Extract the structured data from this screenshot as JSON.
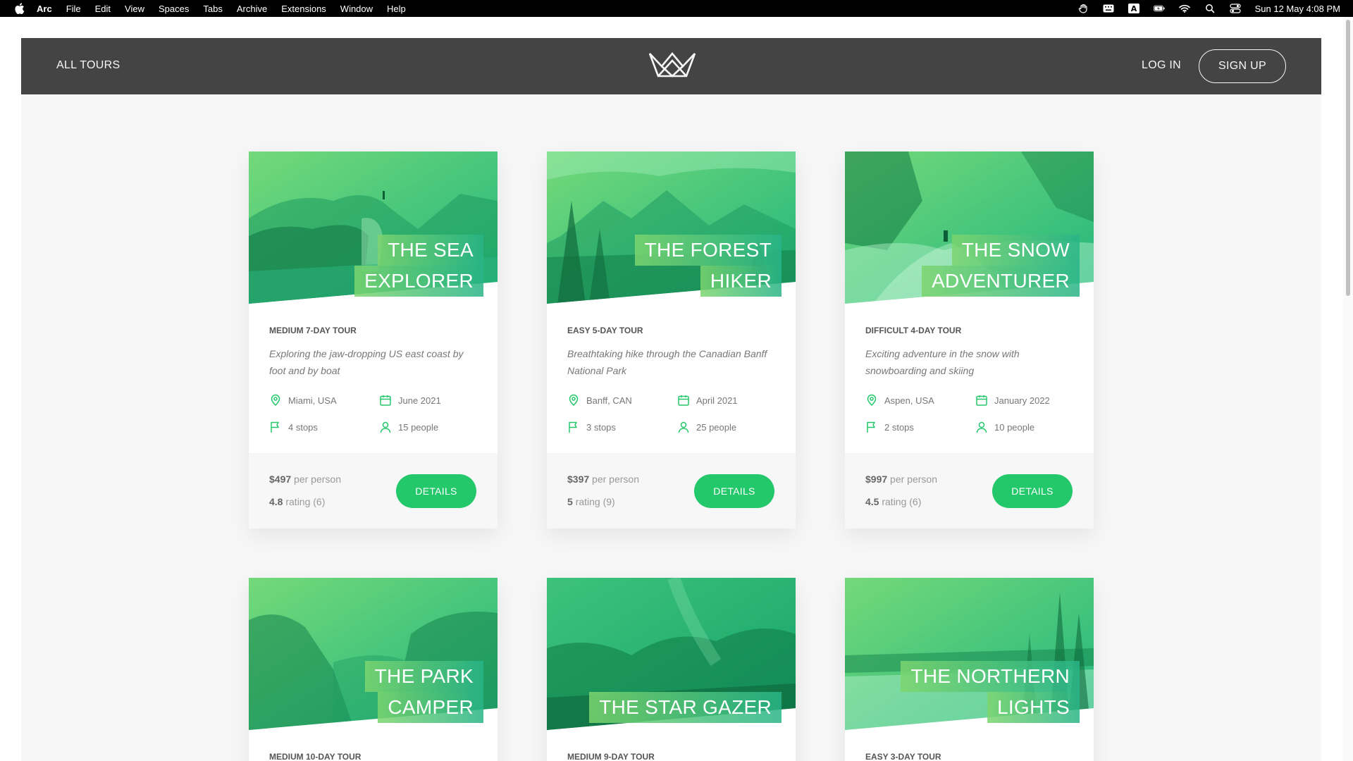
{
  "menubar": {
    "app": "Arc",
    "items": [
      "File",
      "Edit",
      "View",
      "Spaces",
      "Tabs",
      "Archive",
      "Extensions",
      "Window",
      "Help"
    ],
    "clock": "Sun 12 May  4:08 PM",
    "status_icons": [
      "hand-icon",
      "keyboard-icon",
      "input-source-a-icon",
      "battery-icon",
      "wifi-icon",
      "search-icon",
      "control-center-icon"
    ]
  },
  "header": {
    "all_tours": "ALL TOURS",
    "login": "LOG IN",
    "signup": "SIGN UP",
    "logo": "crown-logo-icon"
  },
  "colors": {
    "accent": "#23c86a",
    "header_bg": "#444444",
    "gradient_start": "#7dd56f",
    "gradient_end": "#28b487"
  },
  "tours": [
    {
      "title_lines": [
        "THE SEA",
        "EXPLORER"
      ],
      "subheading": "MEDIUM 7-DAY TOUR",
      "summary": "Exploring the jaw-dropping US east coast by foot and by boat",
      "location": "Miami, USA",
      "date": "June 2021",
      "stops": "4 stops",
      "people": "15 people",
      "price": "$497",
      "price_label": "per person",
      "rating": "4.8",
      "rating_label": "rating (6)",
      "button": "DETAILS"
    },
    {
      "title_lines": [
        "THE FOREST",
        "HIKER"
      ],
      "subheading": "EASY 5-DAY TOUR",
      "summary": "Breathtaking hike through the Canadian Banff National Park",
      "location": "Banff, CAN",
      "date": "April 2021",
      "stops": "3 stops",
      "people": "25 people",
      "price": "$397",
      "price_label": "per person",
      "rating": "5",
      "rating_label": "rating (9)",
      "button": "DETAILS"
    },
    {
      "title_lines": [
        "THE SNOW",
        "ADVENTURER"
      ],
      "subheading": "DIFFICULT 4-DAY TOUR",
      "summary": "Exciting adventure in the snow with snowboarding and skiing",
      "location": "Aspen, USA",
      "date": "January 2022",
      "stops": "2 stops",
      "people": "10 people",
      "price": "$997",
      "price_label": "per person",
      "rating": "4.5",
      "rating_label": "rating (6)",
      "button": "DETAILS"
    },
    {
      "title_lines": [
        "THE PARK",
        "CAMPER"
      ],
      "subheading": "MEDIUM 10-DAY TOUR"
    },
    {
      "title_lines": [
        "THE STAR GAZER"
      ],
      "subheading": "MEDIUM 9-DAY TOUR"
    },
    {
      "title_lines": [
        "THE NORTHERN",
        "LIGHTS"
      ],
      "subheading": "EASY 3-DAY TOUR"
    }
  ]
}
